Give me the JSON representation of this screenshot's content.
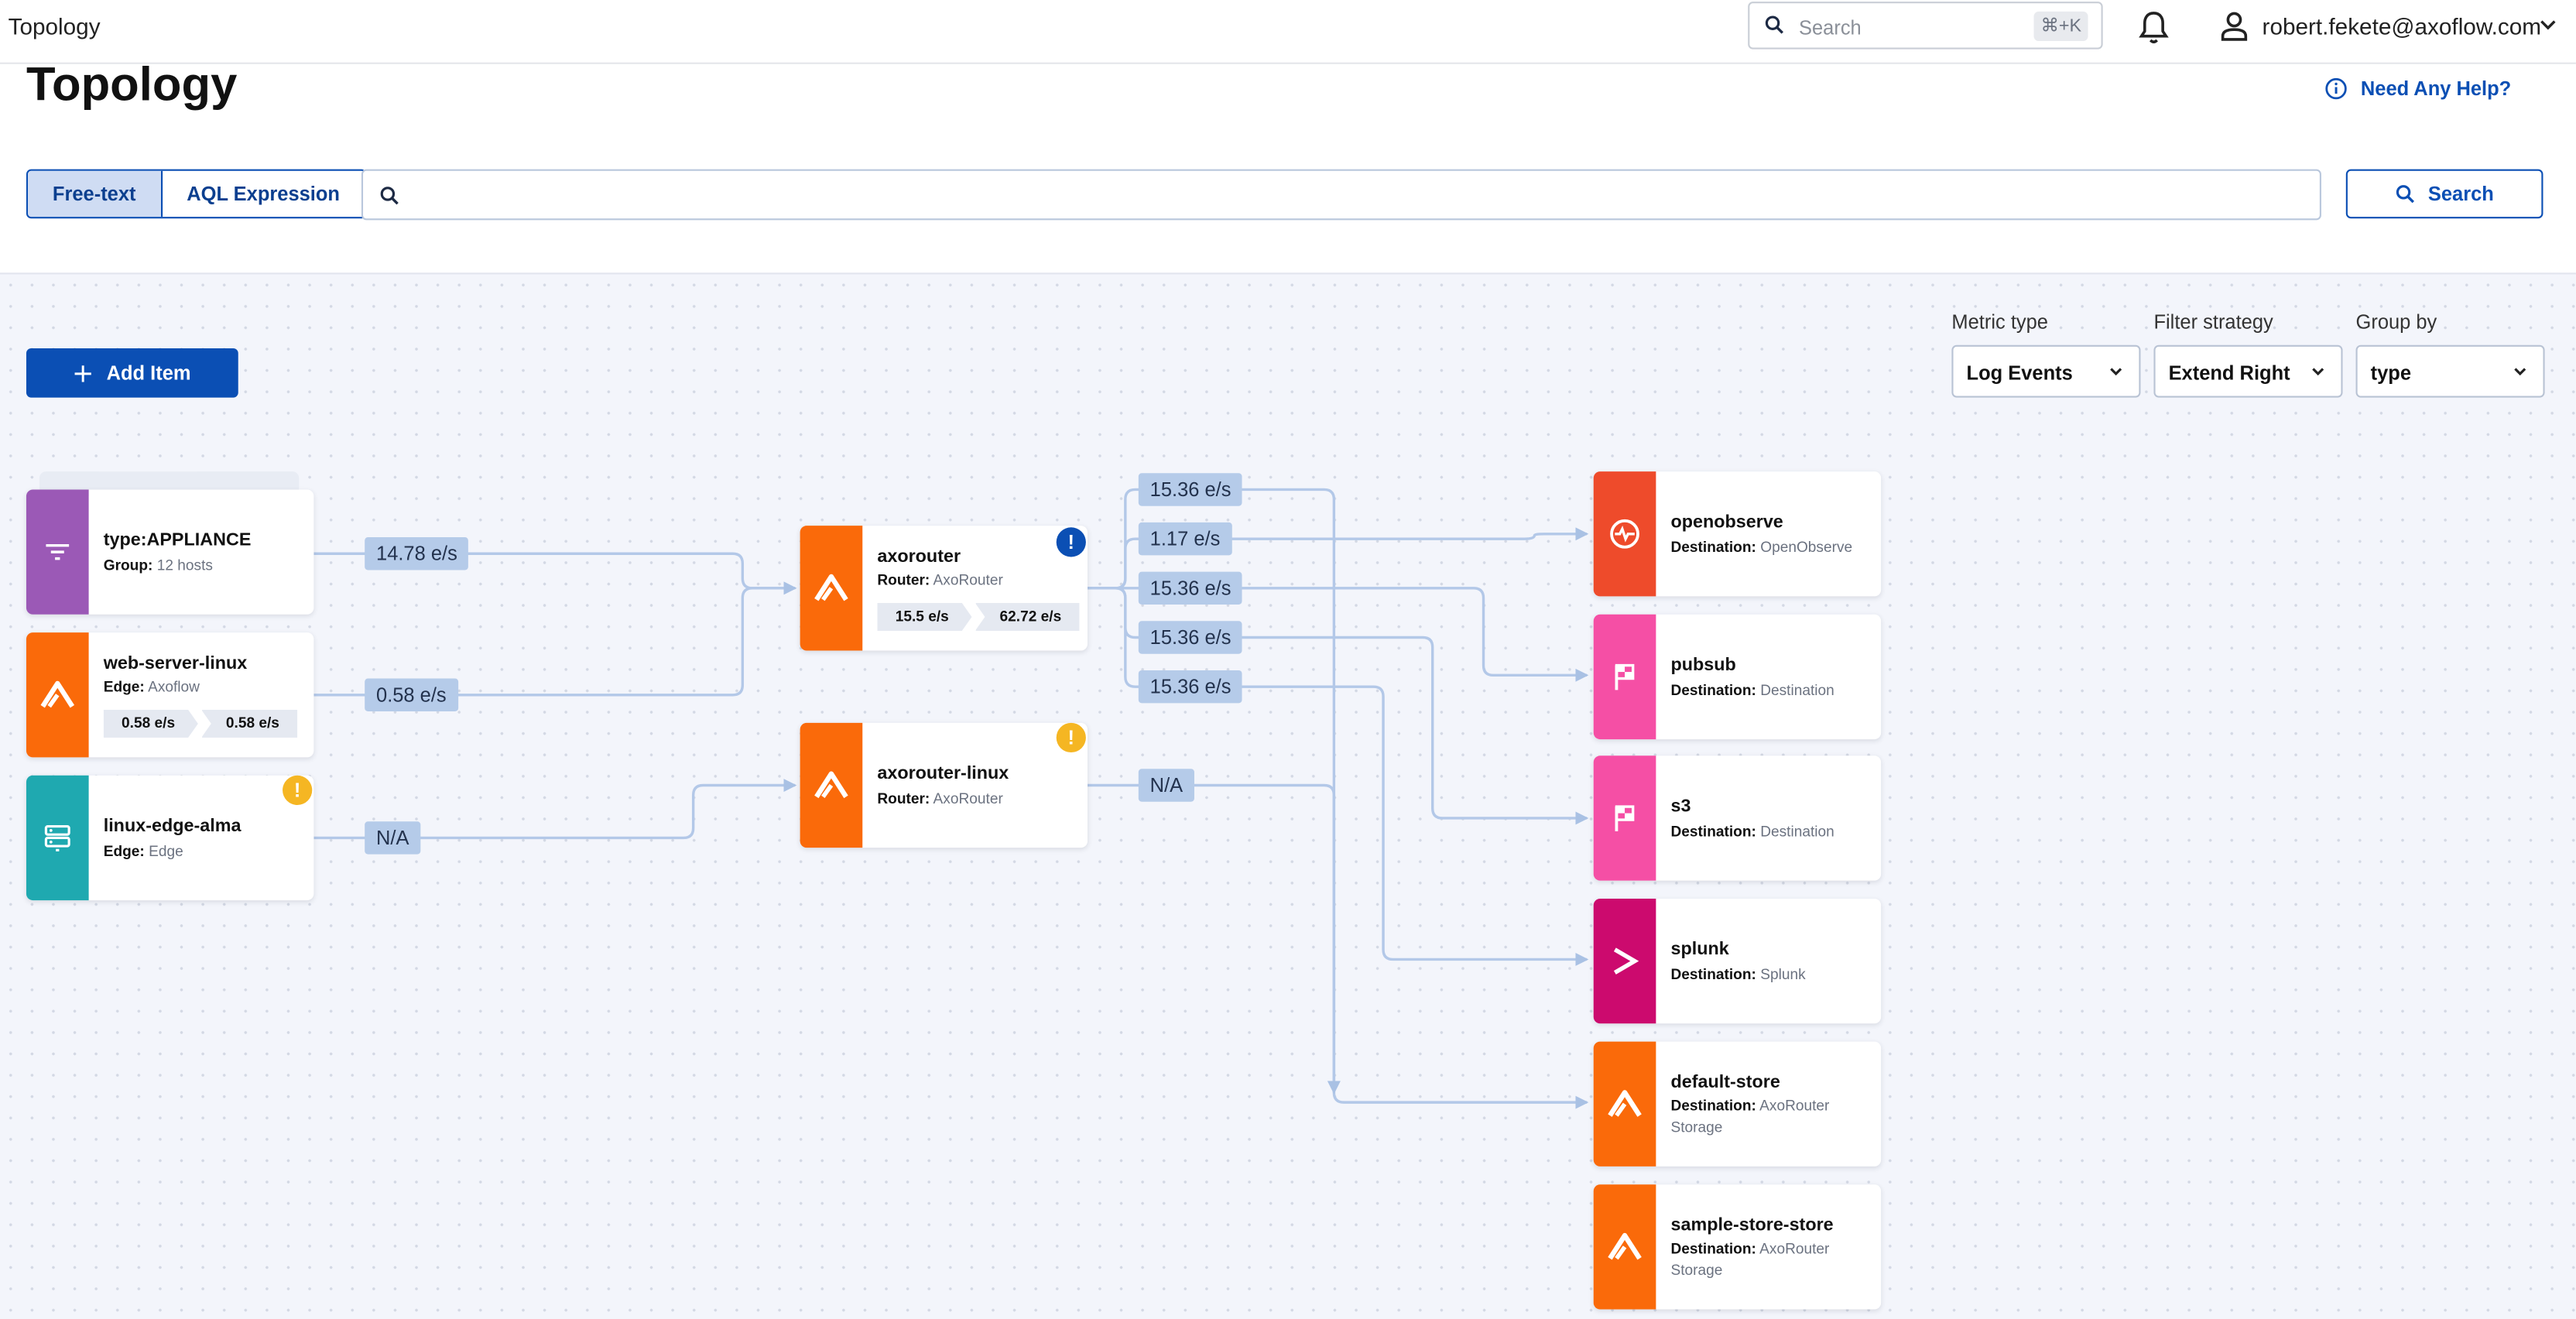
{
  "app": {
    "title": "Topology"
  },
  "topbar": {
    "search_placeholder": "Search",
    "shortcut": "⌘+K",
    "user": "robert.fekete@axoflow.com",
    "icons": [
      "search-icon",
      "bell-icon",
      "user-icon",
      "chevron-down-icon"
    ]
  },
  "page": {
    "title": "Topology",
    "help": "Need Any Help?"
  },
  "query": {
    "modes": [
      "Free-text",
      "AQL Expression"
    ],
    "active_mode": "Free-text",
    "value": "",
    "search_label": "Search"
  },
  "toolbar": {
    "add_label": "Add Item",
    "metric_type": {
      "label": "Metric type",
      "value": "Log Events"
    },
    "filter_strategy": {
      "label": "Filter strategy",
      "value": "Extend Right"
    },
    "group_by": {
      "label": "Group by",
      "value": "type"
    }
  },
  "colors": {
    "accent": "#0b4fb4",
    "purple": "#9b59b6",
    "orange": "#fa6a0a",
    "teal": "#1fa9b0",
    "red": "#ee4b2b",
    "pink": "#f54fa5",
    "magenta": "#cc0a6e",
    "warning": "#f5b623"
  },
  "sources": [
    {
      "name": "type:APPLIANCE",
      "sub_key": "Group:",
      "sub_val": "12 hosts",
      "icon": "filter-icon"
    },
    {
      "name": "web-server-linux",
      "sub_key": "Edge:",
      "sub_val": "Axoflow",
      "rate_in": "0.58 e/s",
      "rate_out": "0.58 e/s",
      "icon": "axoflow-icon"
    },
    {
      "name": "linux-edge-alma",
      "sub_key": "Edge:",
      "sub_val": "Edge",
      "icon": "server-icon",
      "warning": "!"
    }
  ],
  "routers": [
    {
      "name": "axorouter",
      "sub_key": "Router:",
      "sub_val": "AxoRouter",
      "rate_in": "15.5 e/s",
      "rate_out": "62.72 e/s",
      "alert": "!"
    },
    {
      "name": "axorouter-linux",
      "sub_key": "Router:",
      "sub_val": "AxoRouter",
      "warning": "!"
    }
  ],
  "destinations": [
    {
      "name": "openobserve",
      "sub_key": "Destination:",
      "sub_val": "OpenObserve",
      "icon": "openobserve-icon"
    },
    {
      "name": "pubsub",
      "sub_key": "Destination:",
      "sub_val": "Destination",
      "icon": "flag-icon"
    },
    {
      "name": "s3",
      "sub_key": "Destination:",
      "sub_val": "Destination",
      "icon": "flag-icon"
    },
    {
      "name": "splunk",
      "sub_key": "Destination:",
      "sub_val": "Splunk",
      "icon": "splunk-icon"
    },
    {
      "name": "default-store",
      "sub_key": "Destination:",
      "sub_val": "AxoRouter Storage",
      "icon": "axoflow-icon"
    },
    {
      "name": "sample-store-store",
      "sub_key": "Destination:",
      "sub_val": "AxoRouter Storage",
      "icon": "axoflow-icon"
    }
  ],
  "edge_labels": {
    "appliance_to_axorouter": "14.78 e/s",
    "webserver_to_axorouter": "0.58 e/s",
    "alma_to_axorouter_linux": "N/A",
    "axorouter_out_1": "15.36 e/s",
    "axorouter_out_2": "1.17 e/s",
    "axorouter_out_3": "15.36 e/s",
    "axorouter_out_4": "15.36 e/s",
    "axorouter_out_5": "15.36 e/s",
    "axorouter_linux_out": "N/A"
  }
}
